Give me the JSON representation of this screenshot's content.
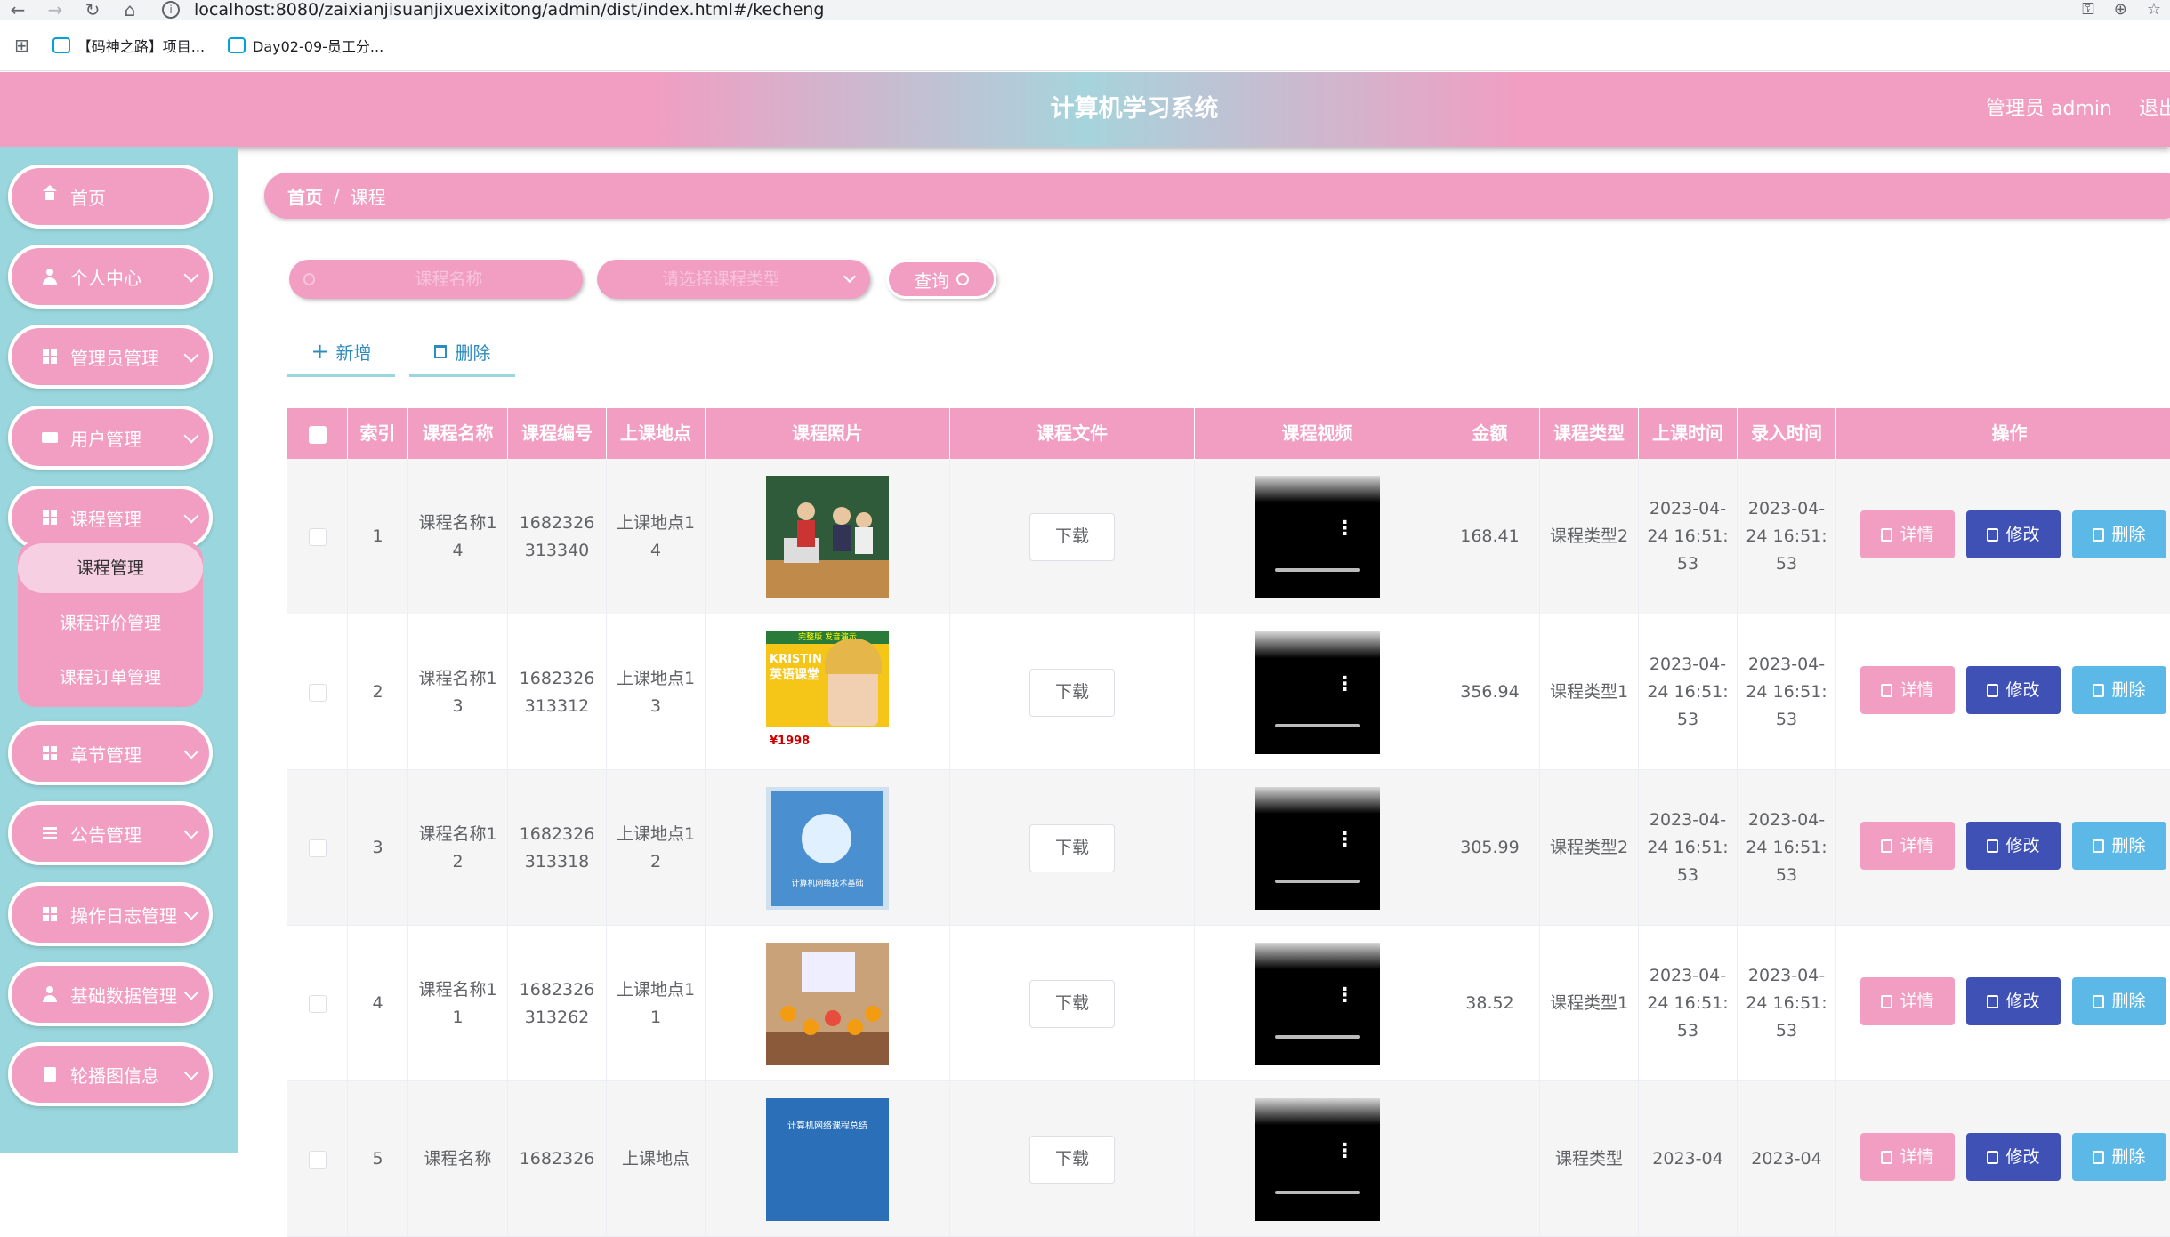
{
  "browser": {
    "url": "localhost:8080/zaixianjisuanjixuexixitong/admin/dist/index.html#/kecheng",
    "bookmarks": [
      "【码神之路】项目...",
      "Day02-09-员工分..."
    ]
  },
  "header": {
    "title": "计算机学习系统",
    "user": "管理员 admin",
    "logout": "退出"
  },
  "sidebar": {
    "items": [
      {
        "label": "首页",
        "icon": "home-icon"
      },
      {
        "label": "个人中心",
        "icon": "user-icon"
      },
      {
        "label": "管理员管理",
        "icon": "grid-icon"
      },
      {
        "label": "用户管理",
        "icon": "video-icon"
      },
      {
        "label": "课程管理",
        "icon": "grid-icon"
      },
      {
        "label": "章节管理",
        "icon": "grid-icon"
      },
      {
        "label": "公告管理",
        "icon": "list-icon"
      },
      {
        "label": "操作日志管理",
        "icon": "grid-icon"
      },
      {
        "label": "基础数据管理",
        "icon": "user-icon"
      },
      {
        "label": "轮播图信息",
        "icon": "clipboard-icon"
      }
    ],
    "submenu": [
      "课程管理",
      "课程评价管理",
      "课程订单管理"
    ]
  },
  "breadcrumb": {
    "home": "首页",
    "separator": "/",
    "current": "课程"
  },
  "search": {
    "name_placeholder": "课程名称",
    "type_placeholder": "请选择课程类型",
    "button": "查询"
  },
  "actions": {
    "add": "新增",
    "delete": "删除"
  },
  "table": {
    "headers": [
      "索引",
      "课程名称",
      "课程编号",
      "上课地点",
      "课程照片",
      "课程文件",
      "课程视频",
      "金额",
      "课程类型",
      "上课时间",
      "录入时间",
      "操作"
    ],
    "download_label": "下载",
    "op_detail": "详情",
    "op_edit": "修改",
    "op_delete": "删除",
    "rows": [
      {
        "index": "1",
        "name": "课程名称14",
        "code": "1682326313340",
        "place": "上课地点14",
        "amount": "168.41",
        "type": "课程类型2",
        "class_time": "2023-04-24 16:51:53",
        "entry_time": "2023-04-24 16:51:53"
      },
      {
        "index": "2",
        "name": "课程名称13",
        "code": "1682326313312",
        "place": "上课地点13",
        "amount": "356.94",
        "type": "课程类型1",
        "class_time": "2023-04-24 16:51:53",
        "entry_time": "2023-04-24 16:51:53"
      },
      {
        "index": "3",
        "name": "课程名称12",
        "code": "1682326313318",
        "place": "上课地点12",
        "amount": "305.99",
        "type": "课程类型2",
        "class_time": "2023-04-24 16:51:53",
        "entry_time": "2023-04-24 16:51:53"
      },
      {
        "index": "4",
        "name": "课程名称11",
        "code": "1682326313262",
        "place": "上课地点11",
        "amount": "38.52",
        "type": "课程类型1",
        "class_time": "2023-04-24 16:51:53",
        "entry_time": "2023-04-24 16:51:53"
      },
      {
        "index": "5",
        "name": "课程名称",
        "code": "1682326",
        "place": "上课地点",
        "amount": "",
        "type": "课程类型",
        "class_time": "2023-04",
        "entry_time": "2023-04"
      }
    ],
    "photo_texts": {
      "row2": [
        "完整版 发音演示",
        "KRISTIN",
        "英语课堂",
        "¥1998"
      ],
      "row3": [
        "计算机网络技术基础"
      ],
      "row5": [
        "计算机网络课程总结"
      ]
    }
  },
  "colors": {
    "accent": "#f19ec2",
    "sidebar": "#9ad6dd",
    "edit": "#3f51b5",
    "delete": "#5cb8e6"
  }
}
